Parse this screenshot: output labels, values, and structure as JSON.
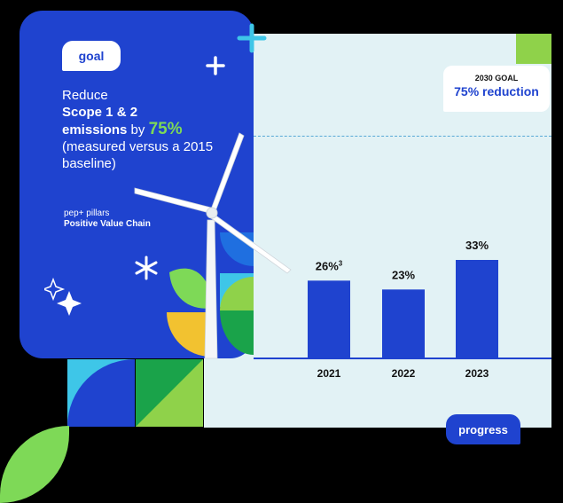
{
  "goal_pill": "goal",
  "headline": {
    "line1": "Reduce",
    "bold1": "Scope 1 & 2",
    "bold2": "emissions",
    "by": "by",
    "pct": "75%",
    "rest": "(measured versus a 2015 baseline)"
  },
  "pillars": {
    "label": "pep+ pillars",
    "value": "Positive Value Chain"
  },
  "callout": {
    "line1": "2030 GOAL",
    "line2": "75% reduction"
  },
  "progress_pill": "progress",
  "colors": {
    "brand_blue": "#1f43cf",
    "accent_green": "#7ed957",
    "panel": "#e2f2f5"
  },
  "chart_data": {
    "type": "bar",
    "categories": [
      "2021",
      "2022",
      "2023"
    ],
    "values": [
      26,
      23,
      33
    ],
    "value_labels": [
      "26%",
      "23%",
      "33%"
    ],
    "footnote_marks": [
      "3",
      "",
      ""
    ],
    "goal_line": 75,
    "title": "",
    "xlabel": "",
    "ylabel": ""
  }
}
